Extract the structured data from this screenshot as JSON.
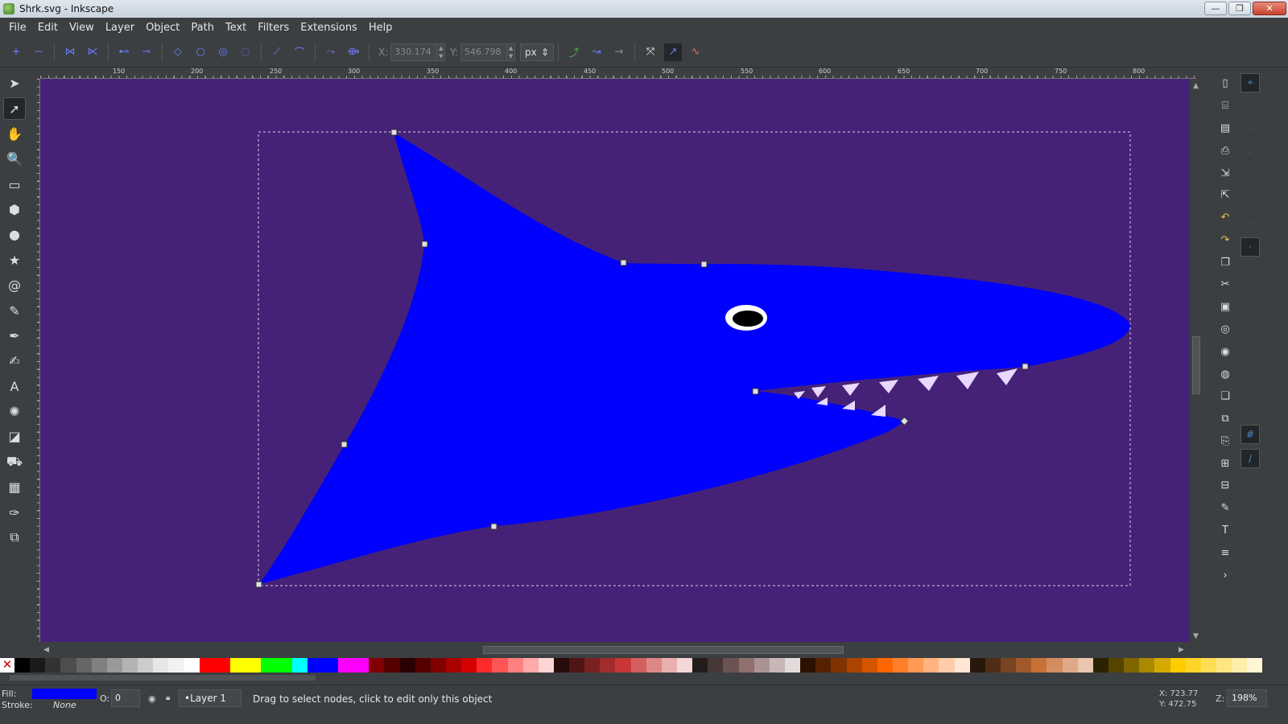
{
  "window": {
    "title": "Shrk.svg - Inkscape",
    "minimize": "—",
    "maximize": "❐",
    "close": "✕"
  },
  "menu": [
    "File",
    "Edit",
    "View",
    "Layer",
    "Object",
    "Path",
    "Text",
    "Filters",
    "Extensions",
    "Help"
  ],
  "controls": {
    "x_label": "X:",
    "x_value": "330.174",
    "y_label": "Y:",
    "y_value": "546.798",
    "unit": "px"
  },
  "ruler": {
    "ticks": [
      "150",
      "200",
      "250",
      "300",
      "350",
      "400",
      "450",
      "500",
      "550",
      "600",
      "650",
      "700",
      "750",
      "800"
    ]
  },
  "tools": [
    {
      "name": "selector-tool-icon",
      "glyph": "➤"
    },
    {
      "name": "node-tool-icon",
      "glyph": "➚",
      "active": true
    },
    {
      "name": "tweak-tool-icon",
      "glyph": "✋"
    },
    {
      "name": "zoom-tool-icon",
      "glyph": "🔍"
    },
    {
      "name": "rectangle-tool-icon",
      "glyph": "▭"
    },
    {
      "name": "3d-box-tool-icon",
      "glyph": "⬢"
    },
    {
      "name": "ellipse-tool-icon",
      "glyph": "●"
    },
    {
      "name": "star-tool-icon",
      "glyph": "★"
    },
    {
      "name": "spiral-tool-icon",
      "glyph": "@"
    },
    {
      "name": "pencil-tool-icon",
      "glyph": "✎"
    },
    {
      "name": "pen-tool-icon",
      "glyph": "✒"
    },
    {
      "name": "calligraphy-tool-icon",
      "glyph": "✍"
    },
    {
      "name": "text-tool-icon",
      "glyph": "A"
    },
    {
      "name": "spray-tool-icon",
      "glyph": "✺"
    },
    {
      "name": "eraser-tool-icon",
      "glyph": "◪"
    },
    {
      "name": "paint-bucket-tool-icon",
      "glyph": "⛟"
    },
    {
      "name": "gradient-tool-icon",
      "glyph": "▦"
    },
    {
      "name": "dropper-tool-icon",
      "glyph": "✑"
    },
    {
      "name": "connector-tool-icon",
      "glyph": "⧉"
    }
  ],
  "commands": [
    "new-document-icon",
    "open-icon",
    "save-icon",
    "print-icon",
    "import-icon",
    "export-icon",
    "undo-icon",
    "redo-icon",
    "copy-icon",
    "cut-icon",
    "paste-icon",
    "zoom-selection-icon",
    "zoom-drawing-icon",
    "zoom-page-icon",
    "duplicate-icon",
    "clone-icon",
    "unlink-clone-icon",
    "group-icon",
    "ungroup-icon",
    "fill-stroke-icon",
    "text-font-icon",
    "layers-icon",
    "expand-icon"
  ],
  "command_glyphs": [
    "▯",
    "⌸",
    "▤",
    "⎙",
    "⇲",
    "⇱",
    "↶",
    "↷",
    "❐",
    "✂",
    "▣",
    "◎",
    "◉",
    "◍",
    "❏",
    "⧉",
    "⎘",
    "⊞",
    "⊟",
    "✎",
    "T",
    "≡",
    "›"
  ],
  "snaps": [
    "snap-toggle-icon",
    "snap-bbox-icon",
    "snap-bbox-edge-icon",
    "snap-bbox-corner-icon",
    "snap-bbox-midpoint-icon",
    "snap-bbox-center-icon",
    "snap-nodes-icon",
    "snap-path-icon",
    "snap-intersection-icon",
    "snap-cusp-icon",
    "snap-smooth-icon",
    "snap-midpoint-icon",
    "snap-object-center-icon",
    "snap-rotation-center-icon",
    "snap-page-border-icon",
    "snap-grid-icon",
    "snap-guide-icon"
  ],
  "colors": {
    "canvas": "#452277",
    "shark": "#0000ff",
    "teeth": "#e8d8ff",
    "palette": [
      "#000000",
      "#1a1a1a",
      "#333333",
      "#4d4d4d",
      "#666666",
      "#808080",
      "#999999",
      "#b3b3b3",
      "#cccccc",
      "#e6e6e6",
      "#f2f2f2",
      "#ffffff",
      "#ff0000",
      "#ff0000",
      "#ffff00",
      "#ffff00",
      "#00ff00",
      "#00ff00",
      "#00ffff",
      "#0000ff",
      "#0000ff",
      "#ff00ff",
      "#ff00ff",
      "#800000",
      "#550000",
      "#2b0000",
      "#550000",
      "#800000",
      "#aa0000",
      "#d40000",
      "#ff2a2a",
      "#ff5555",
      "#ff8080",
      "#ffaaaa",
      "#ffd5d5",
      "#280b0b",
      "#501616",
      "#782121",
      "#a02c2c",
      "#c83737",
      "#d35f5f",
      "#de8787",
      "#e9afaf",
      "#f4d7d7",
      "#241c1c",
      "#483737",
      "#6c5353",
      "#916f6f",
      "#ac9393",
      "#c8b7b7",
      "#e3dbdb",
      "#2b1100",
      "#552200",
      "#803300",
      "#aa4400",
      "#d45500",
      "#ff6600",
      "#ff7f2a",
      "#ff9955",
      "#ffb380",
      "#ffccaa",
      "#ffe6d5",
      "#28170b",
      "#502d16",
      "#784421",
      "#a05a2c",
      "#c87137",
      "#d38d5f",
      "#deaa87",
      "#e9c6af",
      "#2b2200",
      "#554400",
      "#806600",
      "#aa8800",
      "#d4aa00",
      "#ffcc00",
      "#ffd42a",
      "#ffdd55",
      "#ffe680",
      "#ffeeaa",
      "#fff6d5"
    ]
  },
  "status": {
    "fill_label": "Fill:",
    "stroke_label": "Stroke:",
    "stroke_value": "None",
    "opacity_label": "O:",
    "opacity_value": "0",
    "layer": "•Layer 1",
    "message": "Drag to select nodes, click to edit only this object",
    "x_readout": "X: 723.77",
    "y_readout": "Y: 472.75",
    "zoom_label": "Z:",
    "zoom_value": "198%"
  }
}
